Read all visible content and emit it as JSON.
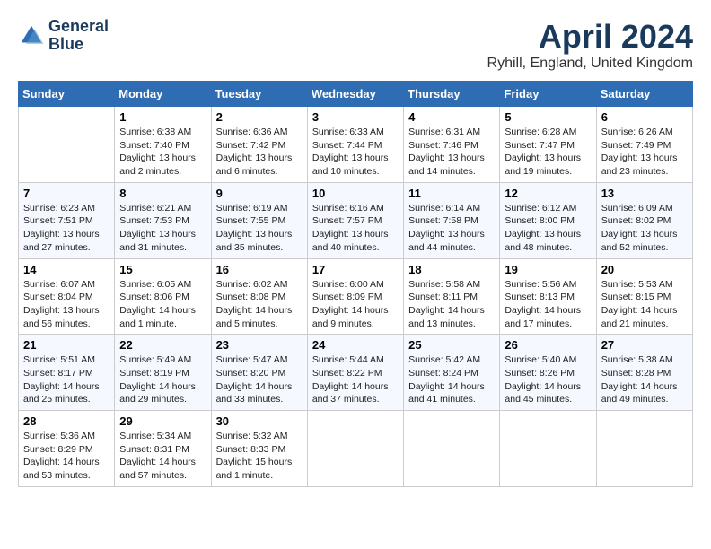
{
  "header": {
    "logo_line1": "General",
    "logo_line2": "Blue",
    "month_title": "April 2024",
    "location": "Ryhill, England, United Kingdom"
  },
  "weekdays": [
    "Sunday",
    "Monday",
    "Tuesday",
    "Wednesday",
    "Thursday",
    "Friday",
    "Saturday"
  ],
  "weeks": [
    [
      {
        "day": "",
        "info": ""
      },
      {
        "day": "1",
        "info": "Sunrise: 6:38 AM\nSunset: 7:40 PM\nDaylight: 13 hours\nand 2 minutes."
      },
      {
        "day": "2",
        "info": "Sunrise: 6:36 AM\nSunset: 7:42 PM\nDaylight: 13 hours\nand 6 minutes."
      },
      {
        "day": "3",
        "info": "Sunrise: 6:33 AM\nSunset: 7:44 PM\nDaylight: 13 hours\nand 10 minutes."
      },
      {
        "day": "4",
        "info": "Sunrise: 6:31 AM\nSunset: 7:46 PM\nDaylight: 13 hours\nand 14 minutes."
      },
      {
        "day": "5",
        "info": "Sunrise: 6:28 AM\nSunset: 7:47 PM\nDaylight: 13 hours\nand 19 minutes."
      },
      {
        "day": "6",
        "info": "Sunrise: 6:26 AM\nSunset: 7:49 PM\nDaylight: 13 hours\nand 23 minutes."
      }
    ],
    [
      {
        "day": "7",
        "info": "Sunrise: 6:23 AM\nSunset: 7:51 PM\nDaylight: 13 hours\nand 27 minutes."
      },
      {
        "day": "8",
        "info": "Sunrise: 6:21 AM\nSunset: 7:53 PM\nDaylight: 13 hours\nand 31 minutes."
      },
      {
        "day": "9",
        "info": "Sunrise: 6:19 AM\nSunset: 7:55 PM\nDaylight: 13 hours\nand 35 minutes."
      },
      {
        "day": "10",
        "info": "Sunrise: 6:16 AM\nSunset: 7:57 PM\nDaylight: 13 hours\nand 40 minutes."
      },
      {
        "day": "11",
        "info": "Sunrise: 6:14 AM\nSunset: 7:58 PM\nDaylight: 13 hours\nand 44 minutes."
      },
      {
        "day": "12",
        "info": "Sunrise: 6:12 AM\nSunset: 8:00 PM\nDaylight: 13 hours\nand 48 minutes."
      },
      {
        "day": "13",
        "info": "Sunrise: 6:09 AM\nSunset: 8:02 PM\nDaylight: 13 hours\nand 52 minutes."
      }
    ],
    [
      {
        "day": "14",
        "info": "Sunrise: 6:07 AM\nSunset: 8:04 PM\nDaylight: 13 hours\nand 56 minutes."
      },
      {
        "day": "15",
        "info": "Sunrise: 6:05 AM\nSunset: 8:06 PM\nDaylight: 14 hours\nand 1 minute."
      },
      {
        "day": "16",
        "info": "Sunrise: 6:02 AM\nSunset: 8:08 PM\nDaylight: 14 hours\nand 5 minutes."
      },
      {
        "day": "17",
        "info": "Sunrise: 6:00 AM\nSunset: 8:09 PM\nDaylight: 14 hours\nand 9 minutes."
      },
      {
        "day": "18",
        "info": "Sunrise: 5:58 AM\nSunset: 8:11 PM\nDaylight: 14 hours\nand 13 minutes."
      },
      {
        "day": "19",
        "info": "Sunrise: 5:56 AM\nSunset: 8:13 PM\nDaylight: 14 hours\nand 17 minutes."
      },
      {
        "day": "20",
        "info": "Sunrise: 5:53 AM\nSunset: 8:15 PM\nDaylight: 14 hours\nand 21 minutes."
      }
    ],
    [
      {
        "day": "21",
        "info": "Sunrise: 5:51 AM\nSunset: 8:17 PM\nDaylight: 14 hours\nand 25 minutes."
      },
      {
        "day": "22",
        "info": "Sunrise: 5:49 AM\nSunset: 8:19 PM\nDaylight: 14 hours\nand 29 minutes."
      },
      {
        "day": "23",
        "info": "Sunrise: 5:47 AM\nSunset: 8:20 PM\nDaylight: 14 hours\nand 33 minutes."
      },
      {
        "day": "24",
        "info": "Sunrise: 5:44 AM\nSunset: 8:22 PM\nDaylight: 14 hours\nand 37 minutes."
      },
      {
        "day": "25",
        "info": "Sunrise: 5:42 AM\nSunset: 8:24 PM\nDaylight: 14 hours\nand 41 minutes."
      },
      {
        "day": "26",
        "info": "Sunrise: 5:40 AM\nSunset: 8:26 PM\nDaylight: 14 hours\nand 45 minutes."
      },
      {
        "day": "27",
        "info": "Sunrise: 5:38 AM\nSunset: 8:28 PM\nDaylight: 14 hours\nand 49 minutes."
      }
    ],
    [
      {
        "day": "28",
        "info": "Sunrise: 5:36 AM\nSunset: 8:29 PM\nDaylight: 14 hours\nand 53 minutes."
      },
      {
        "day": "29",
        "info": "Sunrise: 5:34 AM\nSunset: 8:31 PM\nDaylight: 14 hours\nand 57 minutes."
      },
      {
        "day": "30",
        "info": "Sunrise: 5:32 AM\nSunset: 8:33 PM\nDaylight: 15 hours\nand 1 minute."
      },
      {
        "day": "",
        "info": ""
      },
      {
        "day": "",
        "info": ""
      },
      {
        "day": "",
        "info": ""
      },
      {
        "day": "",
        "info": ""
      }
    ]
  ]
}
